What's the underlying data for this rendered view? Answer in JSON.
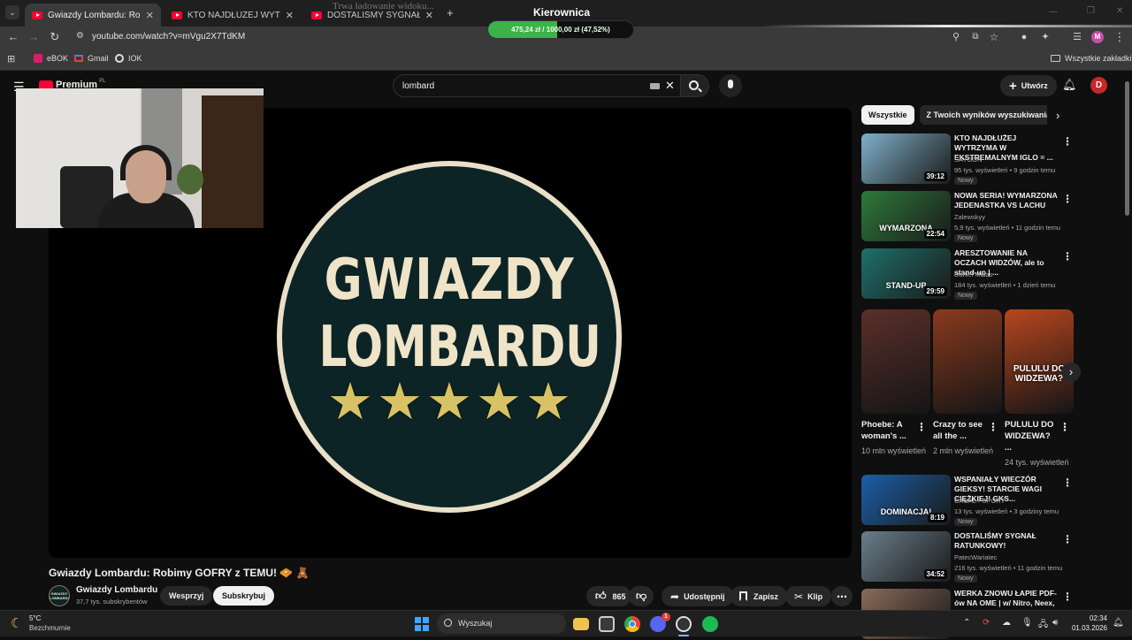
{
  "browser": {
    "window_title": "Kierownica",
    "overlay_text": "Trwa ładowanie widoku...",
    "donation_bar": {
      "text": "475,24 zł / 1000,00 zł (47,52%)",
      "progress": 0.4752
    },
    "tabs": [
      {
        "label": "Gwiazdy Lombardu: Robimy GOFRY",
        "active": true
      },
      {
        "label": "KTO NAJDŁUŻEJ WYTRZYMA W...",
        "active": false
      },
      {
        "label": "DOSTALIŚMY SYGNAŁ RATUNKOWY",
        "active": false
      }
    ],
    "url": "youtube.com/watch?v=mVgu2X7TdKM",
    "bookmarks": [
      "eBOK",
      "Gmail",
      "IOK"
    ],
    "all_bookmarks": "Wszystkie zakładki",
    "profile_initial": "M"
  },
  "youtube": {
    "logo_text": "Premium",
    "logo_region": "PL",
    "search_value": "lombard",
    "create_label": "Utwórz",
    "avatar_initial": "D",
    "player": {
      "brand_line1": "GWIAZDY",
      "brand_line2": "LOMBARDU",
      "stars": 5
    },
    "video_title": "Gwiazdy Lombardu: Robimy GOFRY z TEMU! 🧇 🧸",
    "channel": {
      "name": "Gwiazdy Lombardu",
      "subscribers": "37,7 tys. subskrybentów",
      "logo_text": "GWIAZDY LOMBARDU"
    },
    "buttons": {
      "support": "Wesprzyj",
      "subscribe": "Subskrybuj",
      "likes": "865",
      "share": "Udostępnij",
      "save": "Zapisz",
      "clip": "Klip"
    },
    "chips": [
      "Wszystkie",
      "Z Twoich wyników wyszukiwania"
    ],
    "recommended_top": [
      {
        "title": "KTO NAJDŁUŻEJ WYTRZYMA W EKSTREMALNYM IGLO = ...",
        "channel": "SAYGON",
        "meta": "95 tys. wyświetleń • 9 godzin temu",
        "badge": "Nowy",
        "duration": "39:12",
        "color": "#7fb0c9"
      },
      {
        "title": "NOWA SERIA! WYMARZONA JEDENASTKA VS LACHU",
        "channel": "Zalewskyy",
        "meta": "5,9 tys. wyświetleń • 11 godzin temu",
        "badge": "Nowy",
        "duration": "22:54",
        "color": "#2e7a3a",
        "thumb_text": "WYMARZONA"
      },
      {
        "title": "ARESZTOWANIE NA OCZACH WIDZÓW, ale to stand-up | ...",
        "channel": "Daniel Midas",
        "meta": "184 tys. wyświetleń • 1 dzień temu",
        "badge": "Nowy",
        "duration": "29:59",
        "color": "#1f6f6a",
        "thumb_text": "STAND-UP"
      }
    ],
    "shorts": [
      {
        "title": "Phoebe: A woman's ...",
        "views": "10 mln wyświetleń",
        "color": "#5a2f2a"
      },
      {
        "title": "Crazy to see all the ...",
        "views": "2 mln wyświetleń",
        "color": "#8a3a1e"
      },
      {
        "title": "PULULU DO WIDZEWA? ...",
        "views": "24 tys. wyświetleń",
        "color": "#b8461f",
        "thumb_text": "PULULU DO WIDZEWA?"
      }
    ],
    "recommended_bottom": [
      {
        "title": "WSPANIAŁY WIECZÓR GIEKSY! STARCIE WAGI CIĘŻKIEJ! GKS...",
        "channel": "CANAL+ SPORT",
        "meta": "13 tys. wyświetleń • 3 godziny temu",
        "badge": "Nowy",
        "duration": "8:19",
        "color": "#1b5fa8",
        "thumb_text": "DOMINACJA!"
      },
      {
        "title": "DOSTALIŚMY SYGNAŁ RATUNKOWY!",
        "channel": "PatecWariatec",
        "meta": "216 tys. wyświetleń • 11 godzin temu",
        "badge": "Nowy",
        "duration": "34:52",
        "color": "#6b7e8c"
      },
      {
        "title": "WERKA ZNOWU ŁAPIE PDF-ów NA OME | w/ Nitro, Neex, ...",
        "channel": "",
        "meta": "",
        "badge": "",
        "duration": "",
        "color": "#8a6a5a"
      }
    ]
  },
  "taskbar": {
    "weather_temp": "5°C",
    "weather_desc": "Bezchmurnie",
    "search_placeholder": "Wyszukaj",
    "time": "02:34",
    "date": "01.03.2026",
    "discord_badge": "1"
  }
}
